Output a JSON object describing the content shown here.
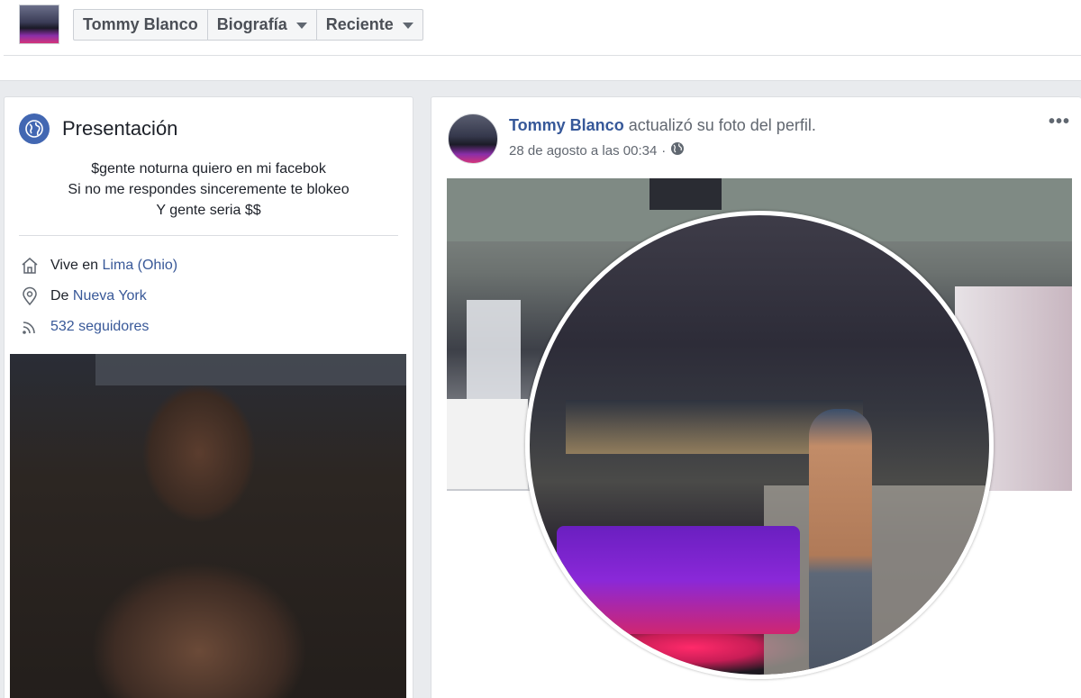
{
  "topbar": {
    "crumbs": [
      {
        "label": "Tommy Blanco",
        "has_caret": false
      },
      {
        "label": "Biografía",
        "has_caret": true
      },
      {
        "label": "Reciente",
        "has_caret": true
      }
    ]
  },
  "intro": {
    "title": "Presentación",
    "bio_lines": [
      "$gente noturna quiero en mi facebok",
      "Si no me respondes sinceremente te blokeo",
      "Y gente seria $$"
    ],
    "lives_prefix": "Vive en",
    "lives_link": "Lima (Ohio)",
    "from_prefix": "De",
    "from_link": "Nueva York",
    "followers": "532 seguidores"
  },
  "post": {
    "author": "Tommy Blanco",
    "action": "actualizó su foto del perfil.",
    "timestamp": "28 de agosto a las 00:34",
    "separator": "·",
    "more": "•••"
  },
  "colors": {
    "link": "#385898",
    "accent": "#4267b2",
    "background": "#e9ebee"
  },
  "icons": [
    "globe-icon",
    "home-icon",
    "location-pin-icon",
    "rss-followers-icon",
    "public-globe-icon",
    "caret-down-icon",
    "more-options-icon"
  ]
}
